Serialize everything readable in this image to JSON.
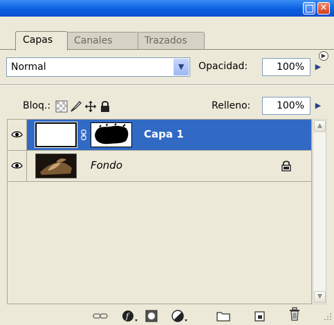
{
  "tabs": [
    {
      "label": "Capas",
      "active": true
    },
    {
      "label": "Canales",
      "active": false
    },
    {
      "label": "Trazados",
      "active": false
    }
  ],
  "blend_mode": {
    "selected": "Normal"
  },
  "opacity": {
    "label": "Opacidad:",
    "value": "100%"
  },
  "lock": {
    "label": "Bloq.:"
  },
  "fill": {
    "label": "Relleno:",
    "value": "100%"
  },
  "layers": [
    {
      "name": "Capa 1",
      "selected": true,
      "visible": true
    },
    {
      "name": "Fondo",
      "selected": false,
      "visible": true,
      "locked": true
    }
  ],
  "colors": {
    "selection": "#316ac5",
    "titlebar": "#0a5fe0",
    "panel": "#ece9d8"
  },
  "icons": {
    "window": [
      "minimize-icon",
      "close-icon"
    ],
    "lock": [
      "lock-transparency-icon",
      "lock-image-icon",
      "lock-position-icon",
      "lock-all-icon"
    ],
    "toolbar": [
      "link-layers-icon",
      "layer-style-icon",
      "layer-mask-icon",
      "adjustment-layer-icon",
      "new-group-icon",
      "new-layer-icon",
      "delete-layer-icon"
    ]
  }
}
